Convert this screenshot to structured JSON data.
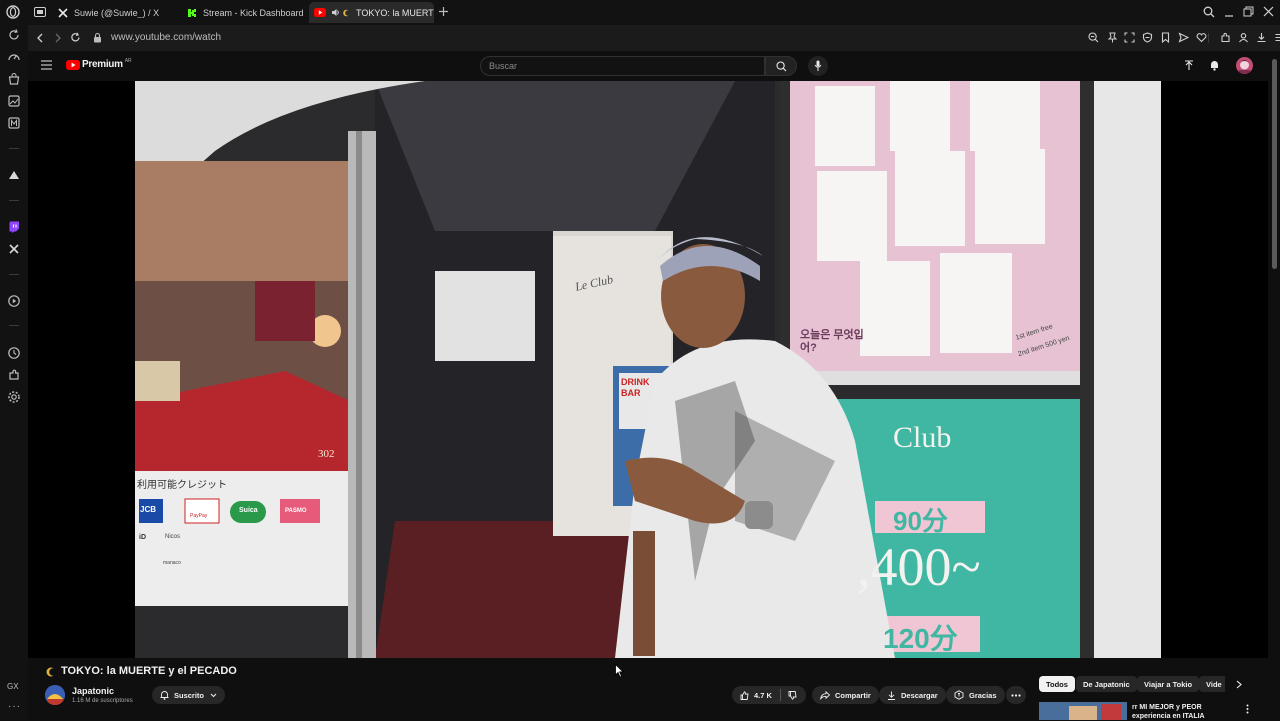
{
  "browser": {
    "tabs": [
      {
        "label": "Suwie (@Suwie_) / X",
        "icon": "x-logo-icon"
      },
      {
        "label": "Stream - Kick Dashboard",
        "icon": "kick-logo-icon"
      },
      {
        "label": "TOKYO: la MUERTE",
        "icon": "youtube-logo-icon",
        "active": true
      }
    ],
    "url": "www.youtube.com/watch",
    "sidebar_label": "GX"
  },
  "youtube": {
    "logo_text": "Premium",
    "logo_region": "AR",
    "search_placeholder": "Buscar"
  },
  "video": {
    "title": "TOKYO: la MUERTE y el PECADO",
    "channel": "Japatonic",
    "subscribers": "1.16 M de suscriptores",
    "subscribe_label": "Suscrito",
    "likes": "4.7 K",
    "share_label": "Compartir",
    "download_label": "Descargar",
    "thanks_label": "Gracias",
    "scene": {
      "room_number": "302",
      "credit_sign": "利用可能クレジット",
      "payment_logos": [
        "JCB",
        "PayPay",
        "Suica",
        "PASMO",
        "iD",
        "Nicos",
        "",
        "nanaco",
        "",
        "",
        "",
        "manaco",
        "",
        "",
        "",
        ""
      ],
      "hotel_sign": "Le Club",
      "drink_sign": "DRINK BAR",
      "club_sign": "Club",
      "price_1": "90分",
      "price_2": ",400~",
      "price_3": "120分",
      "poster_korean": "오늘은 무엇입어?",
      "poster_note_1": "1st item free",
      "poster_note_2": "2nd item 500 yen"
    }
  },
  "chips": [
    {
      "label": "Todos",
      "selected": true
    },
    {
      "label": "De Japatonic"
    },
    {
      "label": "Viajar a Tokio"
    },
    {
      "label": "Vide"
    }
  ],
  "recommended": {
    "title_line1": "rr MI MEJOR y PEOR",
    "title_line2": "experiencia en ITALIA"
  },
  "colors": {
    "youtube_red": "#ff0000",
    "background": "#0f0f0f",
    "pill": "#272727",
    "teal_sign": "#3fb7a3",
    "pink_sign": "#e8b0c4"
  }
}
